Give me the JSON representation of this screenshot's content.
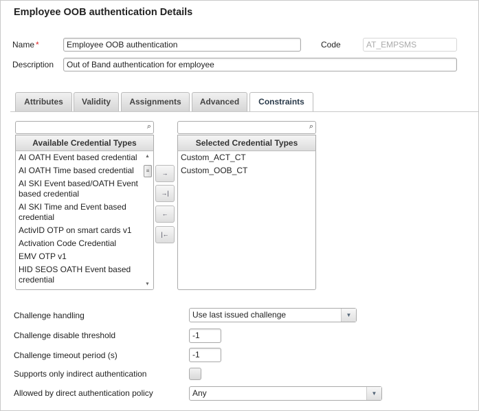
{
  "title": "Employee OOB authentication Details",
  "form": {
    "name_label": "Name",
    "required_mark": "*",
    "name_value": "Employee OOB authentication",
    "code_label": "Code",
    "code_value": "AT_EMPSMS",
    "description_label": "Description",
    "description_value": "Out of Band authentication for employee"
  },
  "tabs": [
    "Attributes",
    "Validity",
    "Assignments",
    "Advanced",
    "Constraints"
  ],
  "active_tab": "Constraints",
  "available": {
    "header": "Available Credential Types",
    "search_value": "",
    "items": [
      "AI OATH Event based credential",
      "AI OATH Time based credential",
      "AI SKI Event based/OATH Event based credential",
      "AI SKI Time and Event based credential",
      "ActivID OTP on smart cards v1",
      "Activation Code Credential",
      "EMV OTP v1",
      "HID SEOS OATH Event based credential"
    ]
  },
  "selected": {
    "header": "Selected Credential Types",
    "search_value": "",
    "items": [
      "Custom_ACT_CT",
      "Custom_OOB_CT"
    ]
  },
  "move_buttons": {
    "add": "→",
    "add_all": "→|",
    "remove": "←",
    "remove_all": "|←"
  },
  "icons": {
    "search": "⌕"
  },
  "settings": {
    "challenge_handling_label": "Challenge handling",
    "challenge_handling_value": "Use last issued challenge",
    "disable_threshold_label": "Challenge disable threshold",
    "disable_threshold_value": "-1",
    "timeout_label": "Challenge timeout period (s)",
    "timeout_value": "-1",
    "indirect_label": "Supports only indirect authentication",
    "indirect_checked": false,
    "direct_policy_label": "Allowed by direct authentication policy",
    "direct_policy_value": "Any"
  }
}
